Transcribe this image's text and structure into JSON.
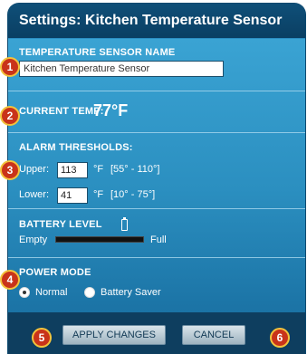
{
  "dialog": {
    "title": "Settings: Kitchen Temperature Sensor"
  },
  "sensor_name": {
    "label": "TEMPERATURE SENSOR NAME",
    "value": "Kitchen Temperature Sensor"
  },
  "current_temp": {
    "label": "CURRENT TEMP:",
    "value": "77°F"
  },
  "alarm": {
    "label": "ALARM THRESHOLDS:",
    "upper_label": "Upper:",
    "upper_value": "113",
    "upper_unit": "°F",
    "upper_range": "[55° - 110°]",
    "lower_label": "Lower:",
    "lower_value": "41",
    "lower_unit": "°F",
    "lower_range": "[10° - 75°]"
  },
  "battery": {
    "label": "BATTERY LEVEL",
    "empty_label": "Empty",
    "full_label": "Full",
    "level": 1.0,
    "icon": "battery-icon"
  },
  "power_mode": {
    "label": "POWER MODE",
    "options": [
      "Normal",
      "Battery Saver"
    ],
    "selected": "Normal"
  },
  "buttons": {
    "apply": "APPLY CHANGES",
    "cancel": "CANCEL"
  },
  "markers": [
    "1",
    "2",
    "3",
    "4",
    "5",
    "6"
  ],
  "colors": {
    "marker_fill": "#c9331a",
    "marker_border": "#f3c33c",
    "title_bar": "#0f4f78",
    "panel": "#2b8fc0",
    "footer": "#0e3e5f"
  }
}
